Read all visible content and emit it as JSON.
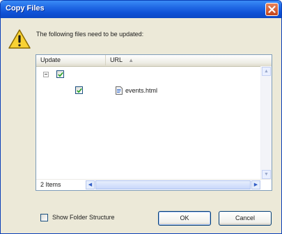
{
  "window": {
    "title": "Copy Files"
  },
  "message": "The following files need to be updated:",
  "list": {
    "columns": [
      {
        "label": "Update"
      },
      {
        "label": "URL",
        "sort_indicator": "▲"
      }
    ],
    "parent_row": {
      "checked": true,
      "expanded": true
    },
    "rows": [
      {
        "checked": true,
        "icon": "html-file-icon",
        "name": "events.html"
      }
    ],
    "items_count": "2 Items"
  },
  "show_folder_structure": {
    "label": "Show Folder Structure",
    "checked": false
  },
  "buttons": {
    "ok": "OK",
    "cancel": "Cancel"
  },
  "colors": {
    "title_bar": "#0f51d6",
    "dialog_bg": "#ece9d8",
    "close_button": "#c3451c",
    "warning_yellow": "#f9d233"
  }
}
